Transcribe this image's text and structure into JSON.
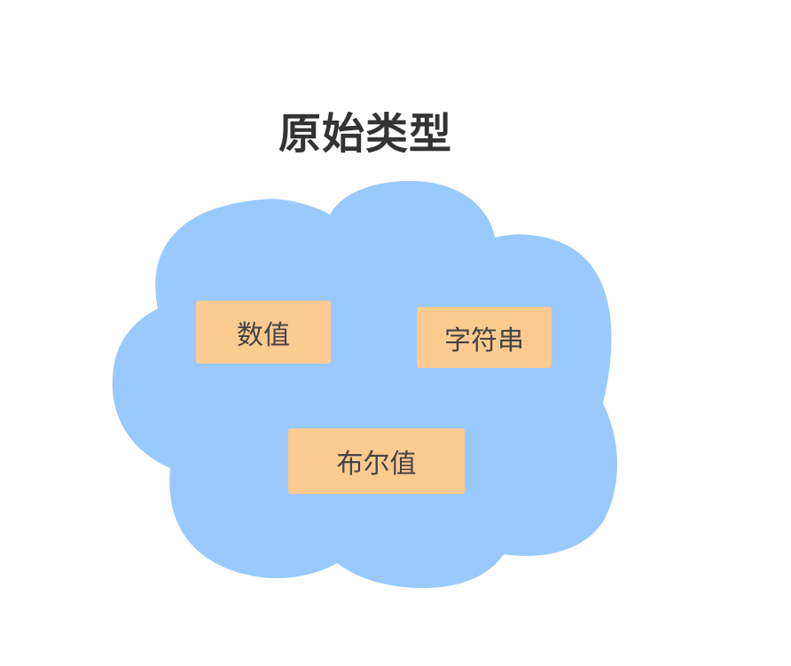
{
  "diagram": {
    "title": "原始类型",
    "cloud_color": "#9ac9fd",
    "tag_color": "#fdca90",
    "types": [
      {
        "label": "数值"
      },
      {
        "label": "字符串"
      },
      {
        "label": "布尔值"
      }
    ]
  }
}
